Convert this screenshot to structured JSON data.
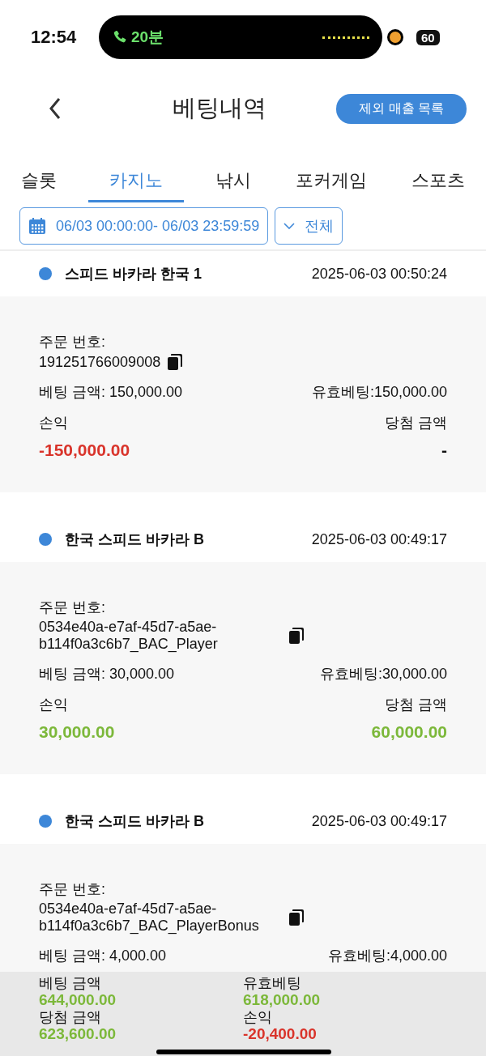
{
  "status_bar": {
    "time": "12:54",
    "call_duration": "20분",
    "battery": "60"
  },
  "header": {
    "title": "베팅내역",
    "action": "제외 매출 목록"
  },
  "tabs": [
    {
      "label": "슬롯",
      "selected": false
    },
    {
      "label": "카지노",
      "selected": true
    },
    {
      "label": "낚시",
      "selected": false
    },
    {
      "label": "포커게임",
      "selected": false
    },
    {
      "label": "스포츠",
      "selected": false
    }
  ],
  "filter": {
    "date_range": "06/03 00:00:00- 06/03 23:59:59",
    "type": "전체"
  },
  "bets": [
    {
      "game": "스피드 바카라 한국 1",
      "time": "2025-06-03 00:50:24",
      "order_label": "주문 번호:",
      "order_no": "191251766009008",
      "bet": "베팅 금액: 150,000.00",
      "valid_bet": "유효베팅:150,000.00",
      "profit": {
        "label": "손익",
        "value": "-150,000.00",
        "color": "#d9342b"
      },
      "win": {
        "label": "당첨 금액",
        "value": "-",
        "color": "#111111"
      }
    },
    {
      "game": "한국 스피드 바카라 B",
      "time": "2025-06-03 00:49:17",
      "order_label": "주문 번호:",
      "order_no": "0534e40a-e7af-45d7-a5ae-b114f0a3c6b7_BAC_Player",
      "bet": "베팅 금액: 30,000.00",
      "valid_bet": "유효베팅:30,000.00",
      "profit": {
        "label": "손익",
        "value": "30,000.00",
        "color": "#7cb83a"
      },
      "win": {
        "label": "당첨 금액",
        "value": "60,000.00",
        "color": "#7cb83a"
      }
    },
    {
      "game": "한국 스피드 바카라 B",
      "time": "2025-06-03 00:49:17",
      "order_label": "주문 번호:",
      "order_no": "0534e40a-e7af-45d7-a5ae-b114f0a3c6b7_BAC_PlayerBonus",
      "bet": "베팅 금액: 4,000.00",
      "valid_bet": "유효베팅:4,000.00"
    }
  ],
  "summary": [
    {
      "label": "베팅 금액",
      "value": "644,000.00",
      "color": "#7cb83a"
    },
    {
      "label": "유효베팅",
      "value": "618,000.00",
      "color": "#7cb83a"
    },
    {
      "label": "당첨 금액",
      "value": "623,600.00",
      "color": "#7cb83a"
    },
    {
      "label": "손익",
      "value": "-20,400.00",
      "color": "#d9342b"
    }
  ]
}
